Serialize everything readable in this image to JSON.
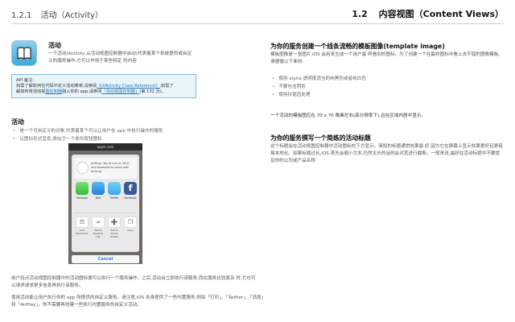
{
  "header": {
    "left_section": "1.2.1",
    "left_title": "活动（Activity）",
    "right_section": "1.2",
    "right_title": "内容视图（Content Views）"
  },
  "icon_block": {
    "icon": "book-icon",
    "title": "活动",
    "description": "一个活动(Activity,从活动视图控制器中启动)代表着某个系统提供或自定义的服务操作,它可以作用于某些特定 的内容"
  },
  "api_note": {
    "label": "API 备注:",
    "line1_prefix": "如需了解如何在代码中定义活动菜单,请参阅",
    "line1_link": "《UIActivity Class Reference》",
    "line1_suffix": ",如需了",
    "line2_prefix": "解如何将活动视",
    "line2_link1": "图控制器",
    "line2_mid": "融入你的 app,请参阅",
    "line2_link2": "「活动视图控制器」",
    "line2_suffix": "(第 132 页)。"
  },
  "activity_section": {
    "title": "活动",
    "bullets": [
      "是一个可自定义的对象,代表着某个可以让用户在 app 中执行操作的服务",
      "以图标形式呈现,类似于一个条形按钮图标"
    ]
  },
  "phone": {
    "status": "apple.com",
    "airdrop_text": "AirDrop. Tap to turn on Wi-Fi and Bluetooth to share with AirDrop.",
    "apps": [
      {
        "icon": "messages-icon",
        "label": "Message"
      },
      {
        "icon": "mail-icon",
        "label": "Mail"
      },
      {
        "icon": "twitter-icon",
        "label": "Twitter"
      },
      {
        "icon": "facebook-icon",
        "label": "Facebook"
      }
    ],
    "actions": [
      {
        "icon": "bookmark-icon",
        "label": "Add Bookmark"
      },
      {
        "icon": "reading-list-icon",
        "label": "Add to Reading List"
      },
      {
        "icon": "home-screen-icon",
        "label": "Add to Home Screen"
      },
      {
        "icon": "copy-icon",
        "label": "Copy"
      }
    ],
    "cancel": "Cancel"
  },
  "bottom_paras": [
    "用户轻点活动视图控制器中的活动图标便可以执行一个服务操作。之后,活动会立即执行该服务,而在服务比较复杂 时,它也可以请求请求更多信息再执行该服务。",
    "使用活动能让用户执行你的 app 所提供的自定义服务。请注意,iOS 本身提供了一些内置服务,例如「打印」、「Twitter」、「消息」和「AirPlay」。你不需要再创建一些执行内置服务的自定义活动。"
  ],
  "right": {
    "h1": "为你的服务创建一个线条流畅的模板图像(template image)",
    "p1": "模板图像是一张图片,iOS 会用来生成一个用户最 终看到的图标。为了创建一个在最终图标中看上去不错的图像模板,请遵循以下准则:",
    "bullets": [
      "使用 alpha 透明度适当的纯黑色或者纯白色",
      "不要包含阴影",
      "使用抗锯齿处理"
    ],
    "p2": "一个活动的模板图应在 70 x 70 像素左右(高分辨率下),且在区域内居中显示。",
    "h2": "为你的服务撰写一个简练的活动标题",
    "p3": "这个标题会在活动视图控制器中活动图标的下方显示。简短的标题通常效果最 好,因为它在屏幕上显示效果更好且更容易本地化。如果标题过长,iOS 首先会缩小文本,仍然太长的话则会对其进行截断。一般来说,最好在活动标题中不要提及你的公司或产品名称"
  }
}
